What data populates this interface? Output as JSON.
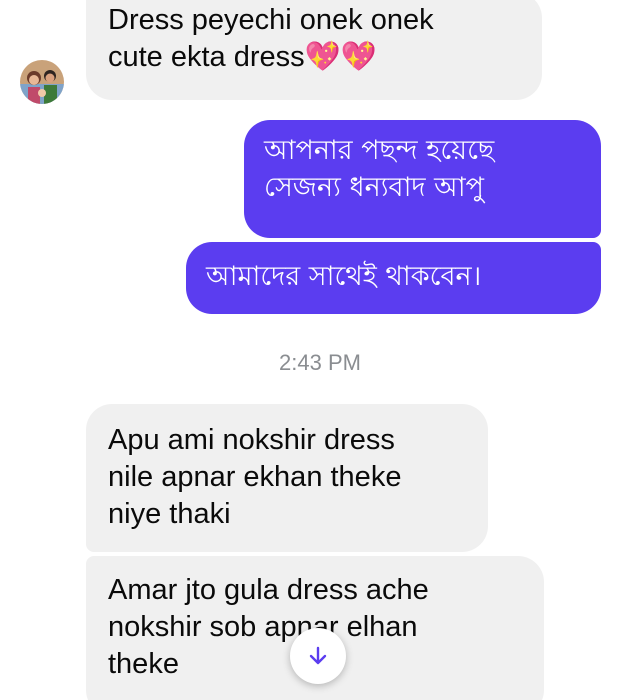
{
  "messages": [
    {
      "text": "Dress peyechi onek onek\ncute ekta dress💖💖"
    },
    {
      "text": "আপনার পছন্দ হয়েছে\nসেজন্য ধন্যবাদ আপু"
    },
    {
      "text": "আমাদের সাথেই থাকবেন।"
    },
    {
      "text": "Apu ami nokshir dress\nnile apnar ekhan theke\nniye thaki"
    },
    {
      "text": "Amar jto gula dress ache\nnokshir sob apnar elhan\ntheke"
    }
  ],
  "timestamp": "2:43 PM",
  "icons": {
    "avatar": "contact-avatar",
    "scroll": "arrow-down-icon"
  },
  "colors": {
    "outgoing_bubble": "#5b3df0",
    "incoming_bubble": "#f0f0f0",
    "scroll_arrow": "#5b3df0"
  }
}
